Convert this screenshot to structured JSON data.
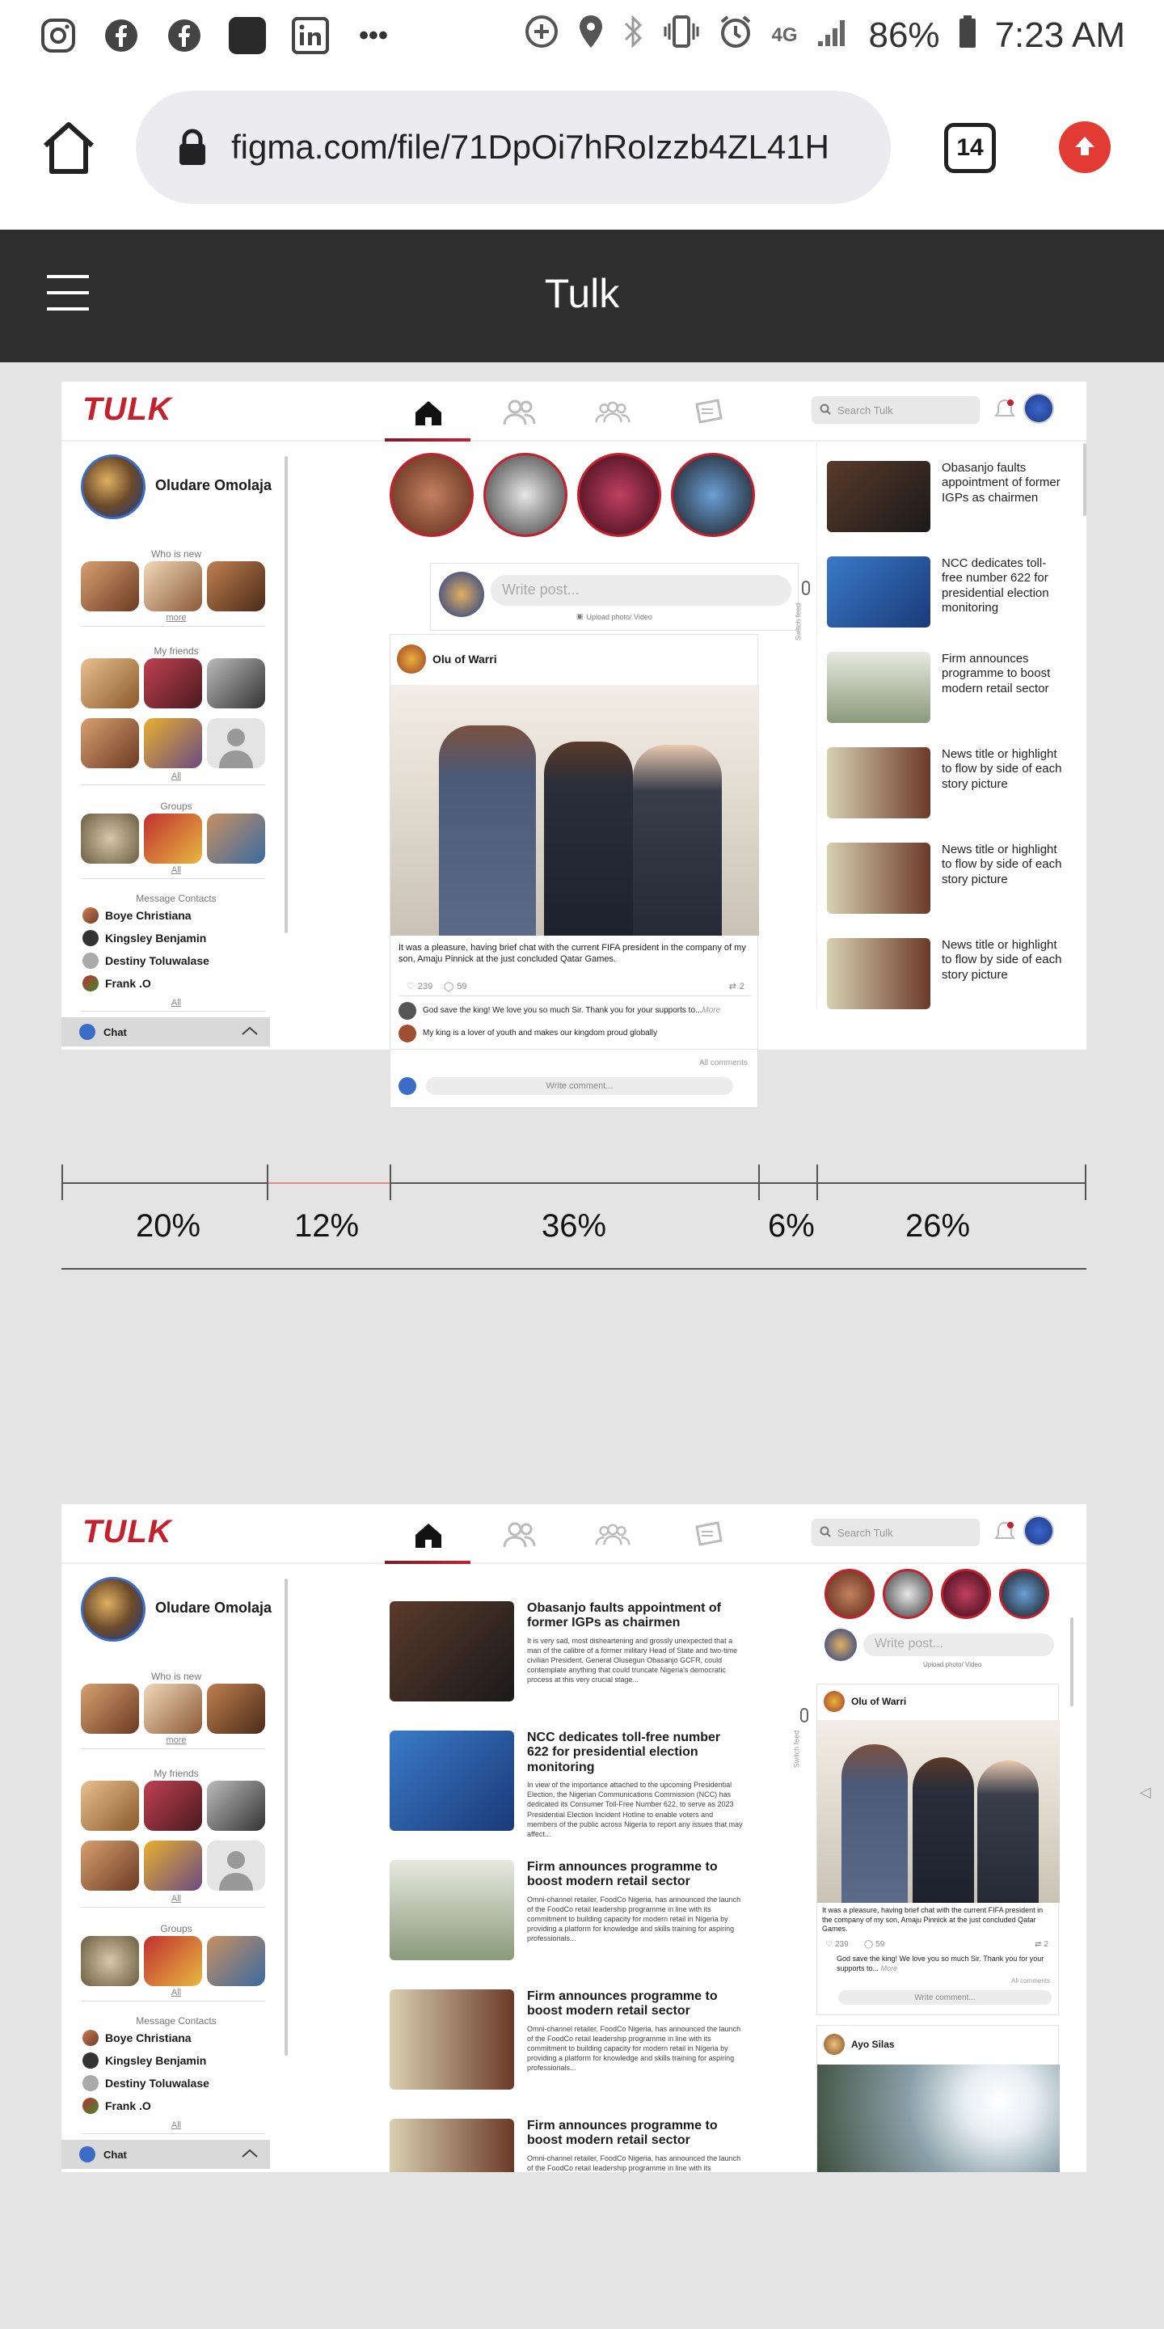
{
  "status_bar": {
    "battery": "86%",
    "time": "7:23 AM",
    "network": "4G",
    "more": "•••"
  },
  "browser": {
    "url": "figma.com/file/71DpOi7hRoIzzb4ZL41H",
    "tab_count": "14"
  },
  "app_bar": {
    "title": "Tulk"
  },
  "design": {
    "logo": "TULK",
    "search_placeholder": "Search Tulk",
    "profile_name": "Oludare Omolaja",
    "who_is_new": "Who is new",
    "more": "more",
    "my_friends": "My friends",
    "all": "All",
    "groups": "Groups",
    "message_contacts": "Message Contacts",
    "contacts": [
      "Boye Christiana",
      "Kingsley Benjamin",
      "Destiny Toluwalase",
      "Frank .O"
    ],
    "chat": "Chat",
    "write_post_placeholder": "Write post...",
    "upload_label": "Upload photo/ Video",
    "switch_feed": "Switch feed",
    "post": {
      "author": "Olu of Warri",
      "caption": "It was a pleasure, having brief chat with the current FIFA president in the company of my son, Amaju Pinnick at the just concluded Qatar Games.",
      "likes": "239",
      "comments": "59",
      "shares": "2",
      "comment1": "God save the king! We love you so much Sir. Thank you for your supports to...",
      "comment1_more": "More",
      "comment2": "My king is a lover of youth and makes our kingdom proud globally",
      "all_comments": "All comments",
      "write_comment": "Write comment..."
    },
    "right_news": [
      "Obasanjo faults appointment of former IGPs as chairmen",
      "NCC dedicates toll-free number 622 for presidential election monitoring",
      "Firm announces programme to boost modern retail sector",
      "News title or highlight to flow by side of each story picture",
      "News title or highlight to flow by side of each story picture",
      "News title or highlight to flow by side of each story picture"
    ],
    "feed": [
      {
        "title": "Obasanjo faults appointment of former IGPs as chairmen",
        "body": "It is very sad, most disheartening and grossly unexpected that a man of the calibre of a former military Head of State and two-time civilian President, General Olusegun Obasanjo GCFR, could contemplate anything that could truncate Nigeria's democratic process at this very crucial stage..."
      },
      {
        "title": "NCC dedicates toll-free number 622 for presidential election monitoring",
        "body": "In view of the importance attached to the upcoming Presidential Election, the Nigerian Communications Commission (NCC) has dedicated its Consumer Toll-Free Number 622, to serve as 2023 Presidential Election Incident Hotline to enable voters and members of the public across Nigeria to report any issues that may affect..."
      },
      {
        "title": "Firm announces programme to boost modern retail sector",
        "body": "Omni-channel retailer, FoodCo Nigeria, has announced the launch of the FoodCo retail leadership programme in line with its commitment to building capacity for modern retail in Nigeria by providing a platform for knowledge and skills training for aspiring professionals..."
      },
      {
        "title": "Firm announces programme to boost modern retail sector",
        "body": "Omni-channel retailer, FoodCo Nigeria, has announced the launch of the FoodCo retail leadership programme in line with its commitment to building capacity for modern retail in Nigeria by providing a platform for knowledge and skills training for aspiring professionals..."
      },
      {
        "title": "Firm announces programme to boost modern retail sector",
        "body": "Omni-channel retailer, FoodCo Nigeria, has announced the launch of the FoodCo retail leadership programme in line with its commitment to building capacity for modern retail in Nigeria"
      }
    ],
    "second_post_author": "Ayo Silas"
  },
  "ruler": {
    "labels": [
      "20%",
      "12%",
      "36%",
      "6%",
      "26%"
    ]
  },
  "colors": {
    "brand_red": "#c4212f",
    "app_bar": "#2e2e2e",
    "page_bg": "#e4e4e4"
  }
}
